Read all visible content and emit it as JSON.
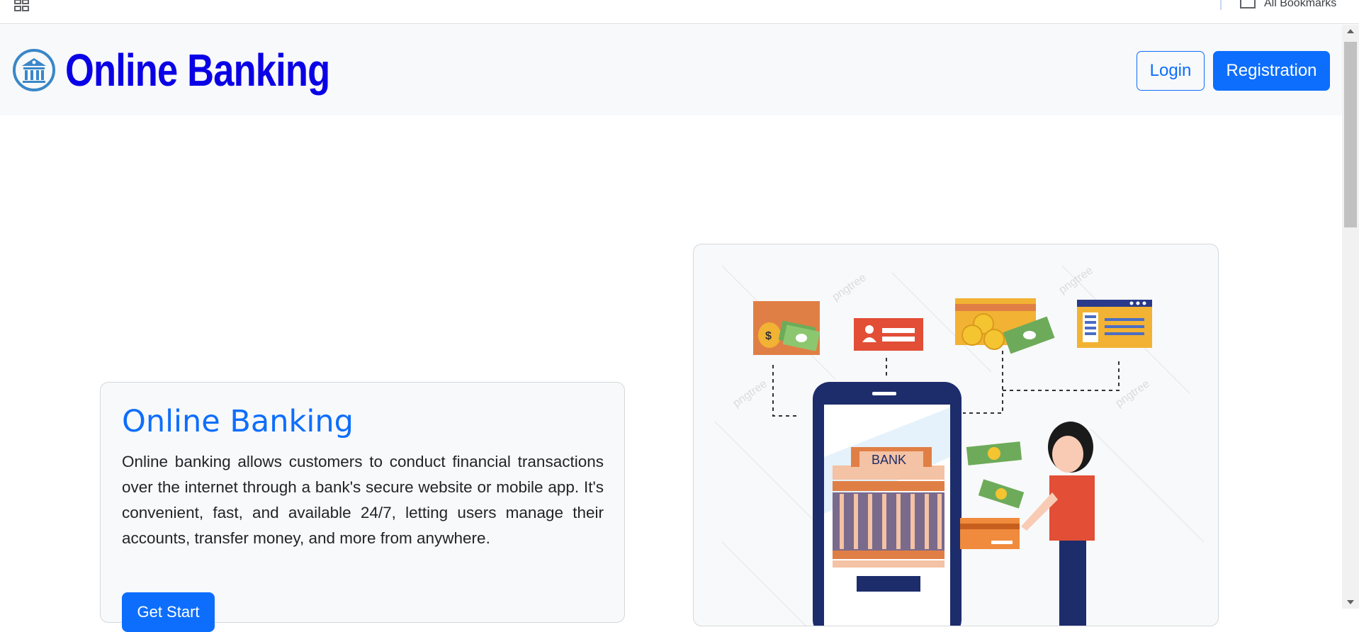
{
  "browser": {
    "bookmarks_label": "All Bookmarks",
    "apps_icon": "apps-grid-icon",
    "folder_icon": "folder-icon"
  },
  "navbar": {
    "brand_title": "Online Banking",
    "brand_icon": "bank-building-icon",
    "login_label": "Login",
    "registration_label": "Registration"
  },
  "hero": {
    "title": "Online Banking",
    "description": "Online banking allows customers to conduct financial transactions over the internet through a bank's secure website or mobile app. It's convenient, fast, and available 24/7, letting users manage their accounts, transfer money, and more from anywhere.",
    "cta_label": "Get Start"
  },
  "illustration": {
    "bank_sign": "BANK",
    "watermark": "pngtree"
  },
  "colors": {
    "brand": "#0a00e6",
    "primary": "#0d6efd",
    "navbar_bg": "#f8f9fa",
    "text": "#212529"
  }
}
